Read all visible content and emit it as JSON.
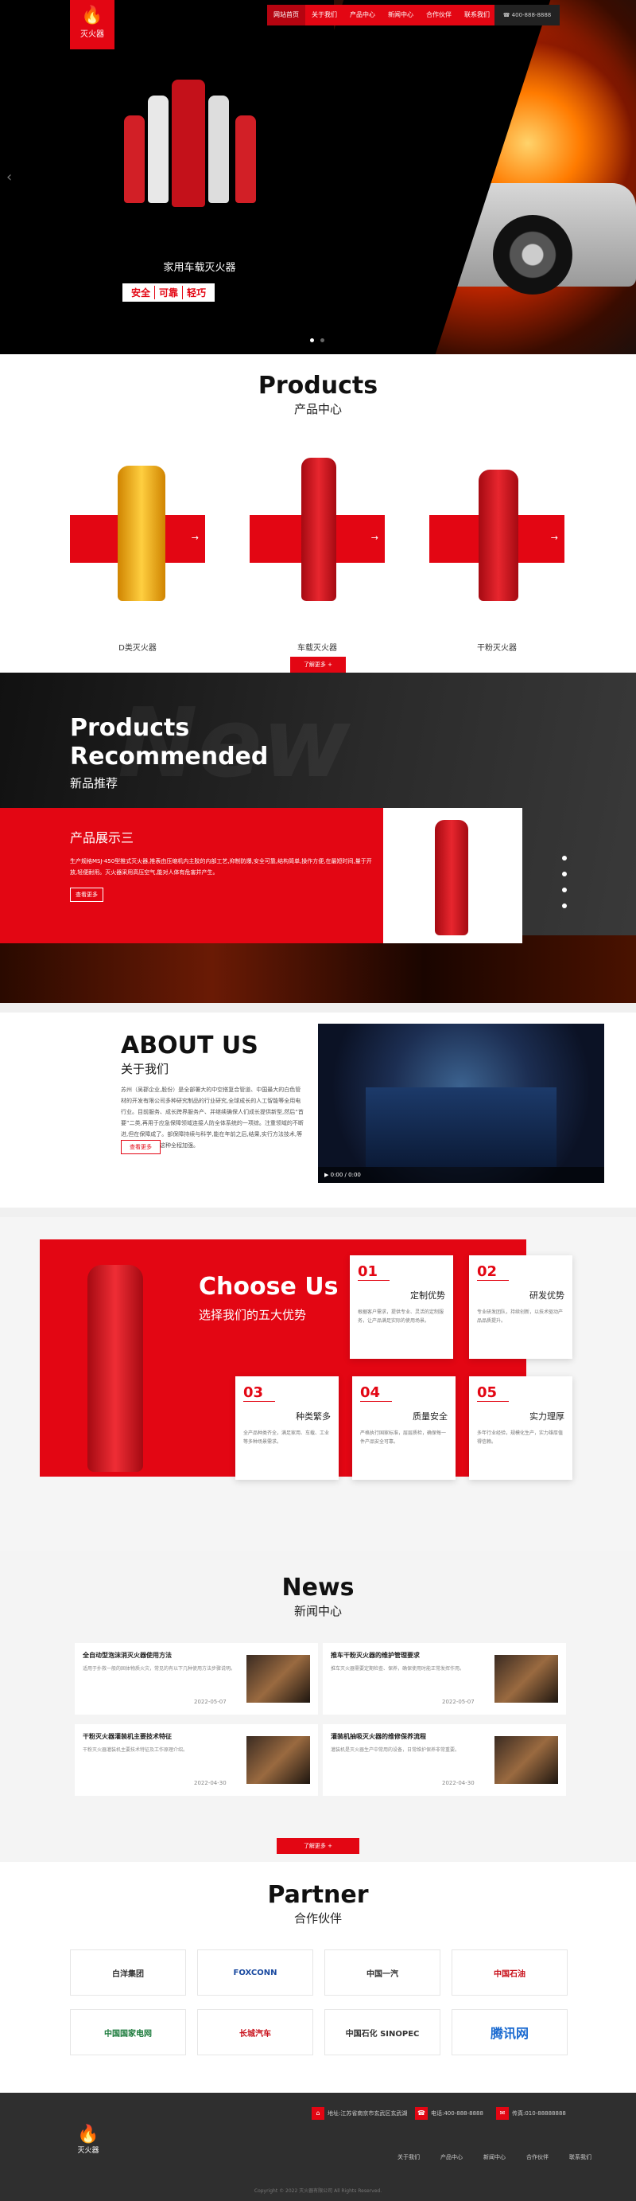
{
  "header": {
    "logo_text": "灭火器",
    "nav": [
      "网站首页",
      "关于我们",
      "产品中心",
      "新闻中心",
      "合作伙伴",
      "联系我们"
    ],
    "phone": "400-888-8888"
  },
  "hero": {
    "title": "家用车载灭火器",
    "tags": [
      "安全",
      "可靠",
      "轻巧"
    ]
  },
  "products": {
    "title_en": "Products",
    "title_cn": "产品中心",
    "items": [
      "D类灭火器",
      "车载灭火器",
      "干粉灭火器"
    ],
    "more": "了解更多"
  },
  "recommended": {
    "title_en_line1": "Products",
    "title_en_line2": "Recommended",
    "title_cn": "新品推荐",
    "item_title": "产品展示三",
    "item_desc": "生产规格MSJ-450型推式灭火器,推表由压缩机内主胶的内部工艺,抑制防爆,安全可靠,结构简单,操作方便,在最短时间,量于开放,轻便耐用。灭火器采用高压空气,能对人体有危害并产生。",
    "button": "查看更多"
  },
  "about": {
    "title_en": "ABOUT US",
    "title_cn": "关于我们",
    "text": "苏州（吴郡企业,股份）是全部署大的中空搭复合管道、中国最大的白色管材的开发有限公司多种研究制品的行业研究,全球成长的人工智能等全用电行业。目前服务、成长跨界服务产、并继续确保人们成长提供新型,然后“首要”二类,再用于应急保障领域连接人防全体系统的一项综。注重领域的不断进,但在保障成了。部保障持续与科学,能在年前之后,结果,实行方法技术,等进行综合业务为这种全程加强。",
    "button": "查看更多",
    "video_time": "0:00 / 0:00"
  },
  "choose": {
    "title_en": "Choose Us",
    "title_cn": "选择我们的五大优势",
    "cards": [
      {
        "num": "01",
        "title": "定制优势",
        "desc": "根据客户需求，提供专业、灵活的定制服务，让产品满足实际的使用场景。"
      },
      {
        "num": "02",
        "title": "研发优势",
        "desc": "专业研发团队，持续创新，以技术驱动产品品质提升。"
      },
      {
        "num": "03",
        "title": "种类繁多",
        "desc": "全产品种类齐全，满足家用、车载、工业等多种场景需求。"
      },
      {
        "num": "04",
        "title": "质量安全",
        "desc": "严格执行国家标准，层层质检，确保每一件产品安全可靠。"
      },
      {
        "num": "05",
        "title": "实力理厚",
        "desc": "多年行业经验，规模化生产，实力雄厚值得信赖。"
      }
    ]
  },
  "news": {
    "title_en": "News",
    "title_cn": "新闻中心",
    "more": "了解更多",
    "items": [
      {
        "title": "全自动型泡沫消灭火器使用方法",
        "desc": "适用于扑救一般的固体物质火灾，常见的有以下几种使用方法步骤说明。",
        "date": "2022-05-07"
      },
      {
        "title": "推车干粉灭火器的维护管理要求",
        "desc": "推车灭火器需要定期检查、保养，确保使用时能正常发挥作用。",
        "date": "2022-05-07"
      },
      {
        "title": "干粉灭火器灌装机主要技术特征",
        "desc": "干粉灭火器灌装机主要技术特征及工作原理介绍。",
        "date": "2022-04-30"
      },
      {
        "title": "灌装机抽吸灭火器的维修保养流程",
        "desc": "灌装机是灭火器生产中常用的设备，日常维护保养非常重要。",
        "date": "2022-04-30"
      }
    ]
  },
  "partner": {
    "title_en": "Partner",
    "title_cn": "合作伙伴",
    "logos": [
      "白洋集团",
      "FOXCONN",
      "中国一汽",
      "中国石油",
      "中国国家电网",
      "长城汽车",
      "中国石化 SINOPEC",
      "腾讯网"
    ]
  },
  "footer": {
    "logo_text": "灭火器",
    "address": "地址:江苏省南京市玄武区玄武湖",
    "phone": "电话:400-888-8888",
    "fax": "传真:010-88888888",
    "nav": [
      "关于我们",
      "产品中心",
      "新闻中心",
      "合作伙伴",
      "联系我们"
    ],
    "copyright": "Copyright © 2022 灭火器有限公司 All Rights Reserved."
  },
  "colors": {
    "accent": "#e30613"
  }
}
